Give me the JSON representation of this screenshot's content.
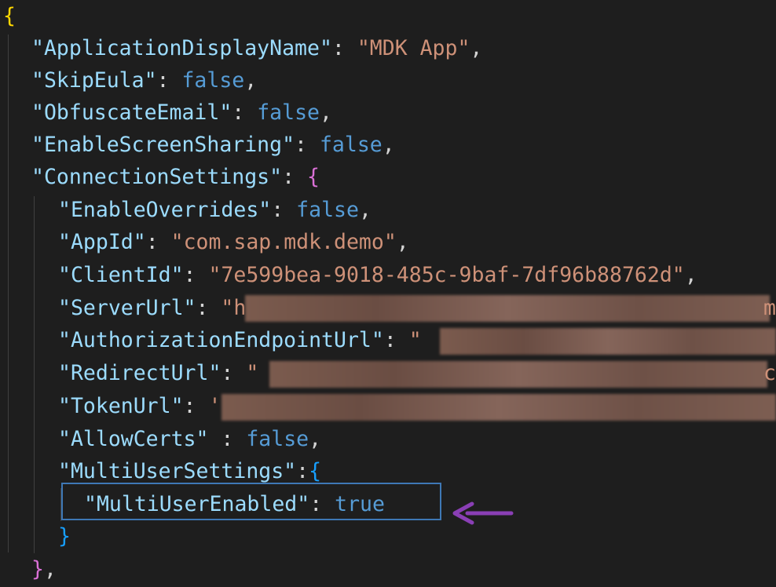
{
  "code": {
    "open_root": "{",
    "app_display_name_key": "\"ApplicationDisplayName\"",
    "app_display_name_value": "\"MDK App\"",
    "skip_eula_key": "\"SkipEula\"",
    "skip_eula_value": "false",
    "obfuscate_email_key": "\"ObfuscateEmail\"",
    "obfuscate_email_value": "false",
    "enable_screen_sharing_key": "\"EnableScreenSharing\"",
    "enable_screen_sharing_value": "false",
    "connection_settings_key": "\"ConnectionSettings\"",
    "connection_open": "{",
    "enable_overrides_key": "\"EnableOverrides\"",
    "enable_overrides_value": "false",
    "app_id_key": "\"AppId\"",
    "app_id_value": "\"com.sap.mdk.demo\"",
    "client_id_key": "\"ClientId\"",
    "client_id_value": "\"7e599bea-9018-485c-9baf-7df96b88762d\"",
    "server_url_key": "\"ServerUrl\"",
    "server_url_value_visible": "\"h",
    "server_url_trailing": "m",
    "auth_endpoint_key": "\"AuthorizationEndpointUrl\"",
    "auth_endpoint_value_visible": "\"",
    "redirect_url_key": "\"RedirectUrl\"",
    "redirect_url_value_visible": "\"",
    "redirect_url_trailing": "c",
    "token_url_key": "\"TokenUrl\"",
    "token_url_value_visible": "'",
    "allow_certs_key": "\"AllowCerts\"",
    "allow_certs_value": "false",
    "multi_user_settings_key": "\"MultiUserSettings\"",
    "multi_user_open": "{",
    "multi_user_enabled_key": "\"MultiUserEnabled\"",
    "multi_user_enabled_value": "true",
    "multi_user_close": "}",
    "connection_close": "}"
  },
  "colors": {
    "background": "#1e1e1e",
    "key": "#9cdcfe",
    "string": "#ce9178",
    "keyword": "#569cd6",
    "brace_level1": "#ffd700",
    "brace_level2": "#da70d6",
    "brace_level3": "#179fff",
    "highlight_box": "#3e78b5",
    "arrow": "#8a3fb5"
  },
  "icons": {
    "annotation_arrow": "left-arrow-icon"
  }
}
